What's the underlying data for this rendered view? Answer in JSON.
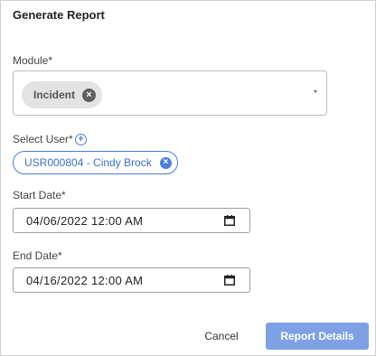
{
  "dialog": {
    "title": "Generate Report"
  },
  "module": {
    "label": "Module*",
    "selected_chip": "Incident",
    "chip_remove_icon": "x-circle-icon",
    "dropdown_icon": "caret-down-icon"
  },
  "user": {
    "label": "Select User*",
    "add_icon": "plus-circle-icon",
    "selected_chip": "USR000804 - Cindy Brock",
    "chip_remove_icon": "x-circle-icon"
  },
  "start_date": {
    "label": "Start Date*",
    "value": "04/06/2022 12:00 AM",
    "calendar_icon": "calendar-icon"
  },
  "end_date": {
    "label": "End Date*",
    "value": "04/16/2022 12:00 AM",
    "calendar_icon": "calendar-icon"
  },
  "actions": {
    "cancel_label": "Cancel",
    "submit_label": "Report Details"
  },
  "colors": {
    "accent": "#4a7fd8",
    "submit_button": "#7ea1e6",
    "chip_bg": "#e3e3e3"
  }
}
